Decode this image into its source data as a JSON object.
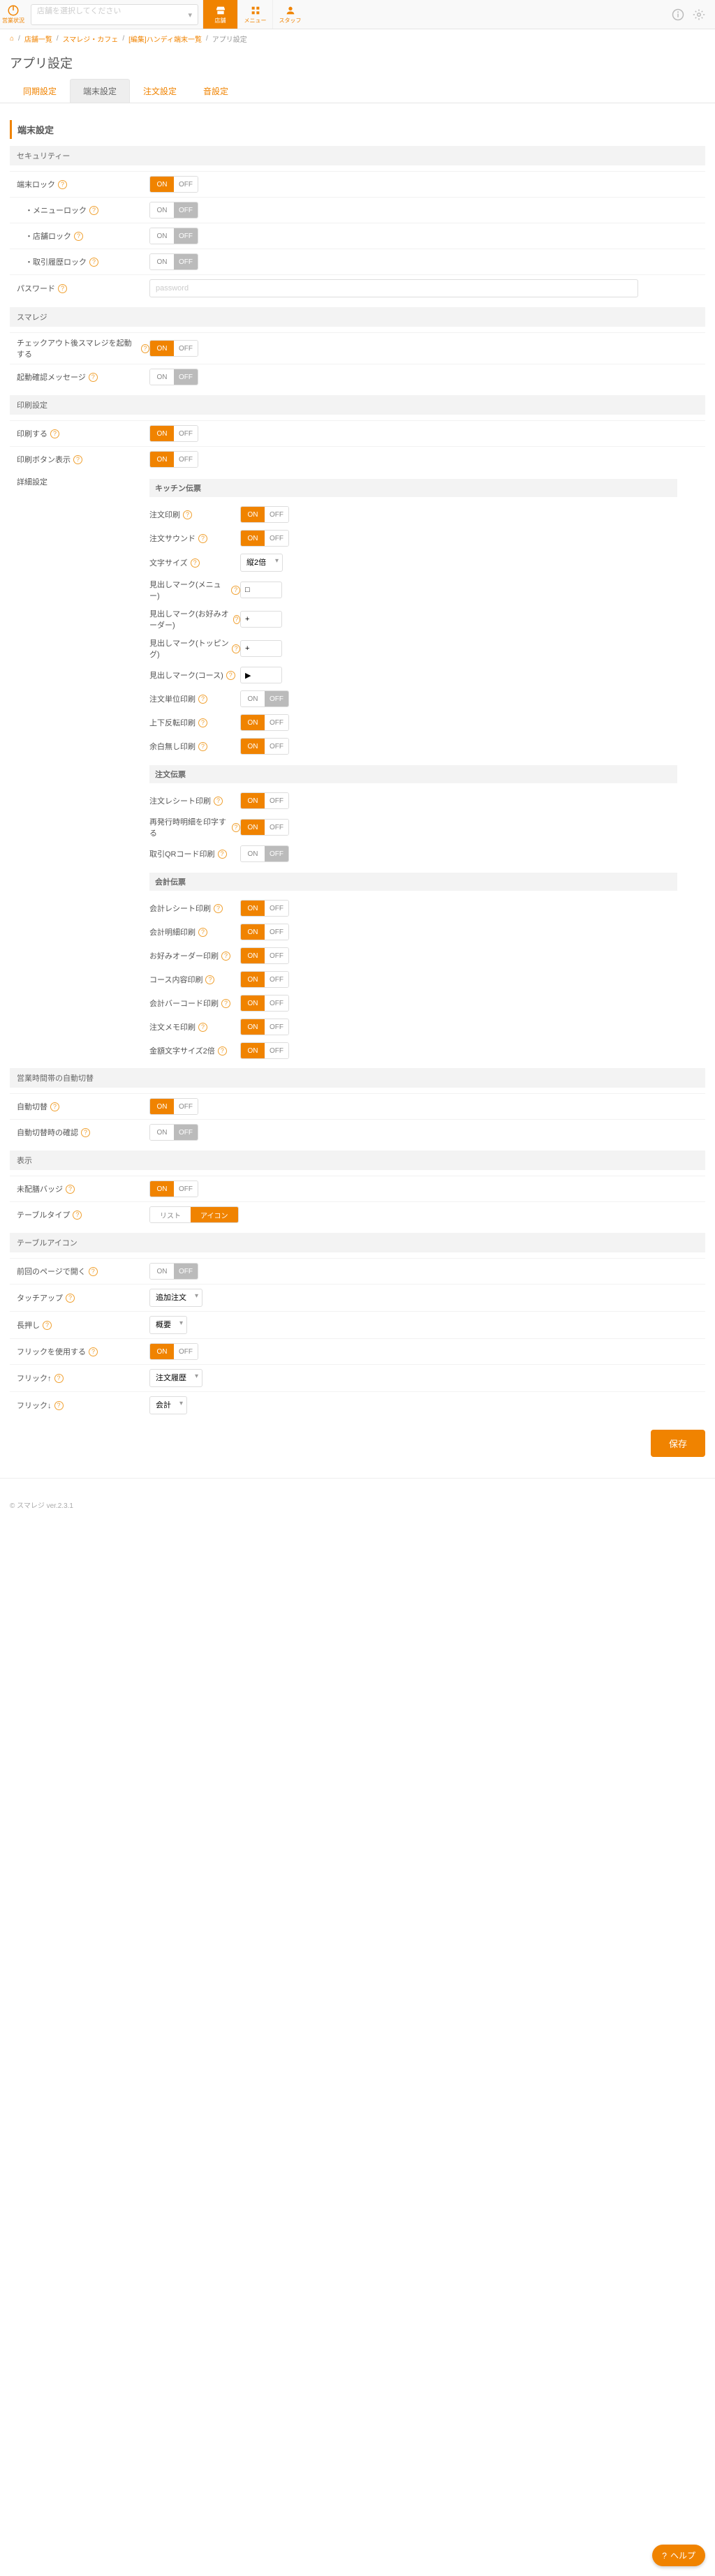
{
  "topbar": {
    "logo_label": "営業状況",
    "store_placeholder": "店舗を選択してください",
    "tabs": [
      {
        "label": "店舗"
      },
      {
        "label": "メニュー"
      },
      {
        "label": "スタッフ"
      }
    ]
  },
  "breadcrumb": {
    "items": [
      "店舗一覧",
      "スマレジ・カフェ",
      "[編集]ハンディ端末一覧"
    ],
    "current": "アプリ設定"
  },
  "page_title": "アプリ設定",
  "maintabs": [
    "同期設定",
    "端末設定",
    "注文設定",
    "音設定"
  ],
  "on": "ON",
  "off": "OFF",
  "section_title": "端末設定",
  "groups": {
    "security": "セキュリティー",
    "smaregi": "スマレジ",
    "print": "印刷設定",
    "auto_switch": "営業時間帯の自動切替",
    "display": "表示",
    "table_icon": "テーブルアイコン"
  },
  "labels": {
    "terminal_lock": "端末ロック",
    "menu_lock": "・メニューロック",
    "store_lock": "・店舗ロック",
    "history_lock": "・取引履歴ロック",
    "password": "パスワード",
    "checkout_launch": "チェックアウト後スマレジを起動する",
    "startup_confirm": "起動確認メッセージ",
    "do_print": "印刷する",
    "print_button": "印刷ボタン表示",
    "detail": "詳細設定",
    "kitchen": "キッチン伝票",
    "order_print": "注文印刷",
    "order_sound": "注文サウンド",
    "font_size": "文字サイズ",
    "mark_menu": "見出しマーク(メニュー)",
    "mark_okonomi": "見出しマーク(お好みオーダー)",
    "mark_topping": "見出しマーク(トッピング)",
    "mark_course": "見出しマーク(コース)",
    "order_unit": "注文単位印刷",
    "upside_down": "上下反転印刷",
    "no_margin": "余白無し印刷",
    "order_slip": "注文伝票",
    "order_receipt": "注文レシート印刷",
    "reissue_detail": "再発行時明細を印字する",
    "qr_print": "取引QRコード印刷",
    "account_slip": "会計伝票",
    "account_receipt": "会計レシート印刷",
    "account_detail": "会計明細印刷",
    "okonomi_print": "お好みオーダー印刷",
    "course_content": "コース内容印刷",
    "barcode_print": "会計バーコード印刷",
    "memo_print": "注文メモ印刷",
    "amount_2x": "金額文字サイズ2倍",
    "auto_switch": "自動切替",
    "auto_switch_confirm": "自動切替時の確認",
    "unassigned_badge": "未配膳バッジ",
    "table_type": "テーブルタイプ",
    "prev_page_open": "前回のページで開く",
    "touch_up": "タッチアップ",
    "long_press": "長押し",
    "use_flick": "フリックを使用する",
    "flick_up": "フリック↑",
    "flick_down": "フリック↓"
  },
  "values": {
    "font_size": "縦2倍",
    "mark_menu": "□",
    "mark_okonomi": "+",
    "mark_topping": "+",
    "mark_course": "▶",
    "table_type_list": "リスト",
    "table_type_icon": "アイコン",
    "touch_up": "追加注文",
    "long_press": "概要",
    "flick_up": "注文履歴",
    "flick_down": "会計"
  },
  "password_placeholder": "password",
  "save": "保存",
  "footer": "© スマレジ  ver.2.3.1",
  "help_fab": "ヘルプ"
}
